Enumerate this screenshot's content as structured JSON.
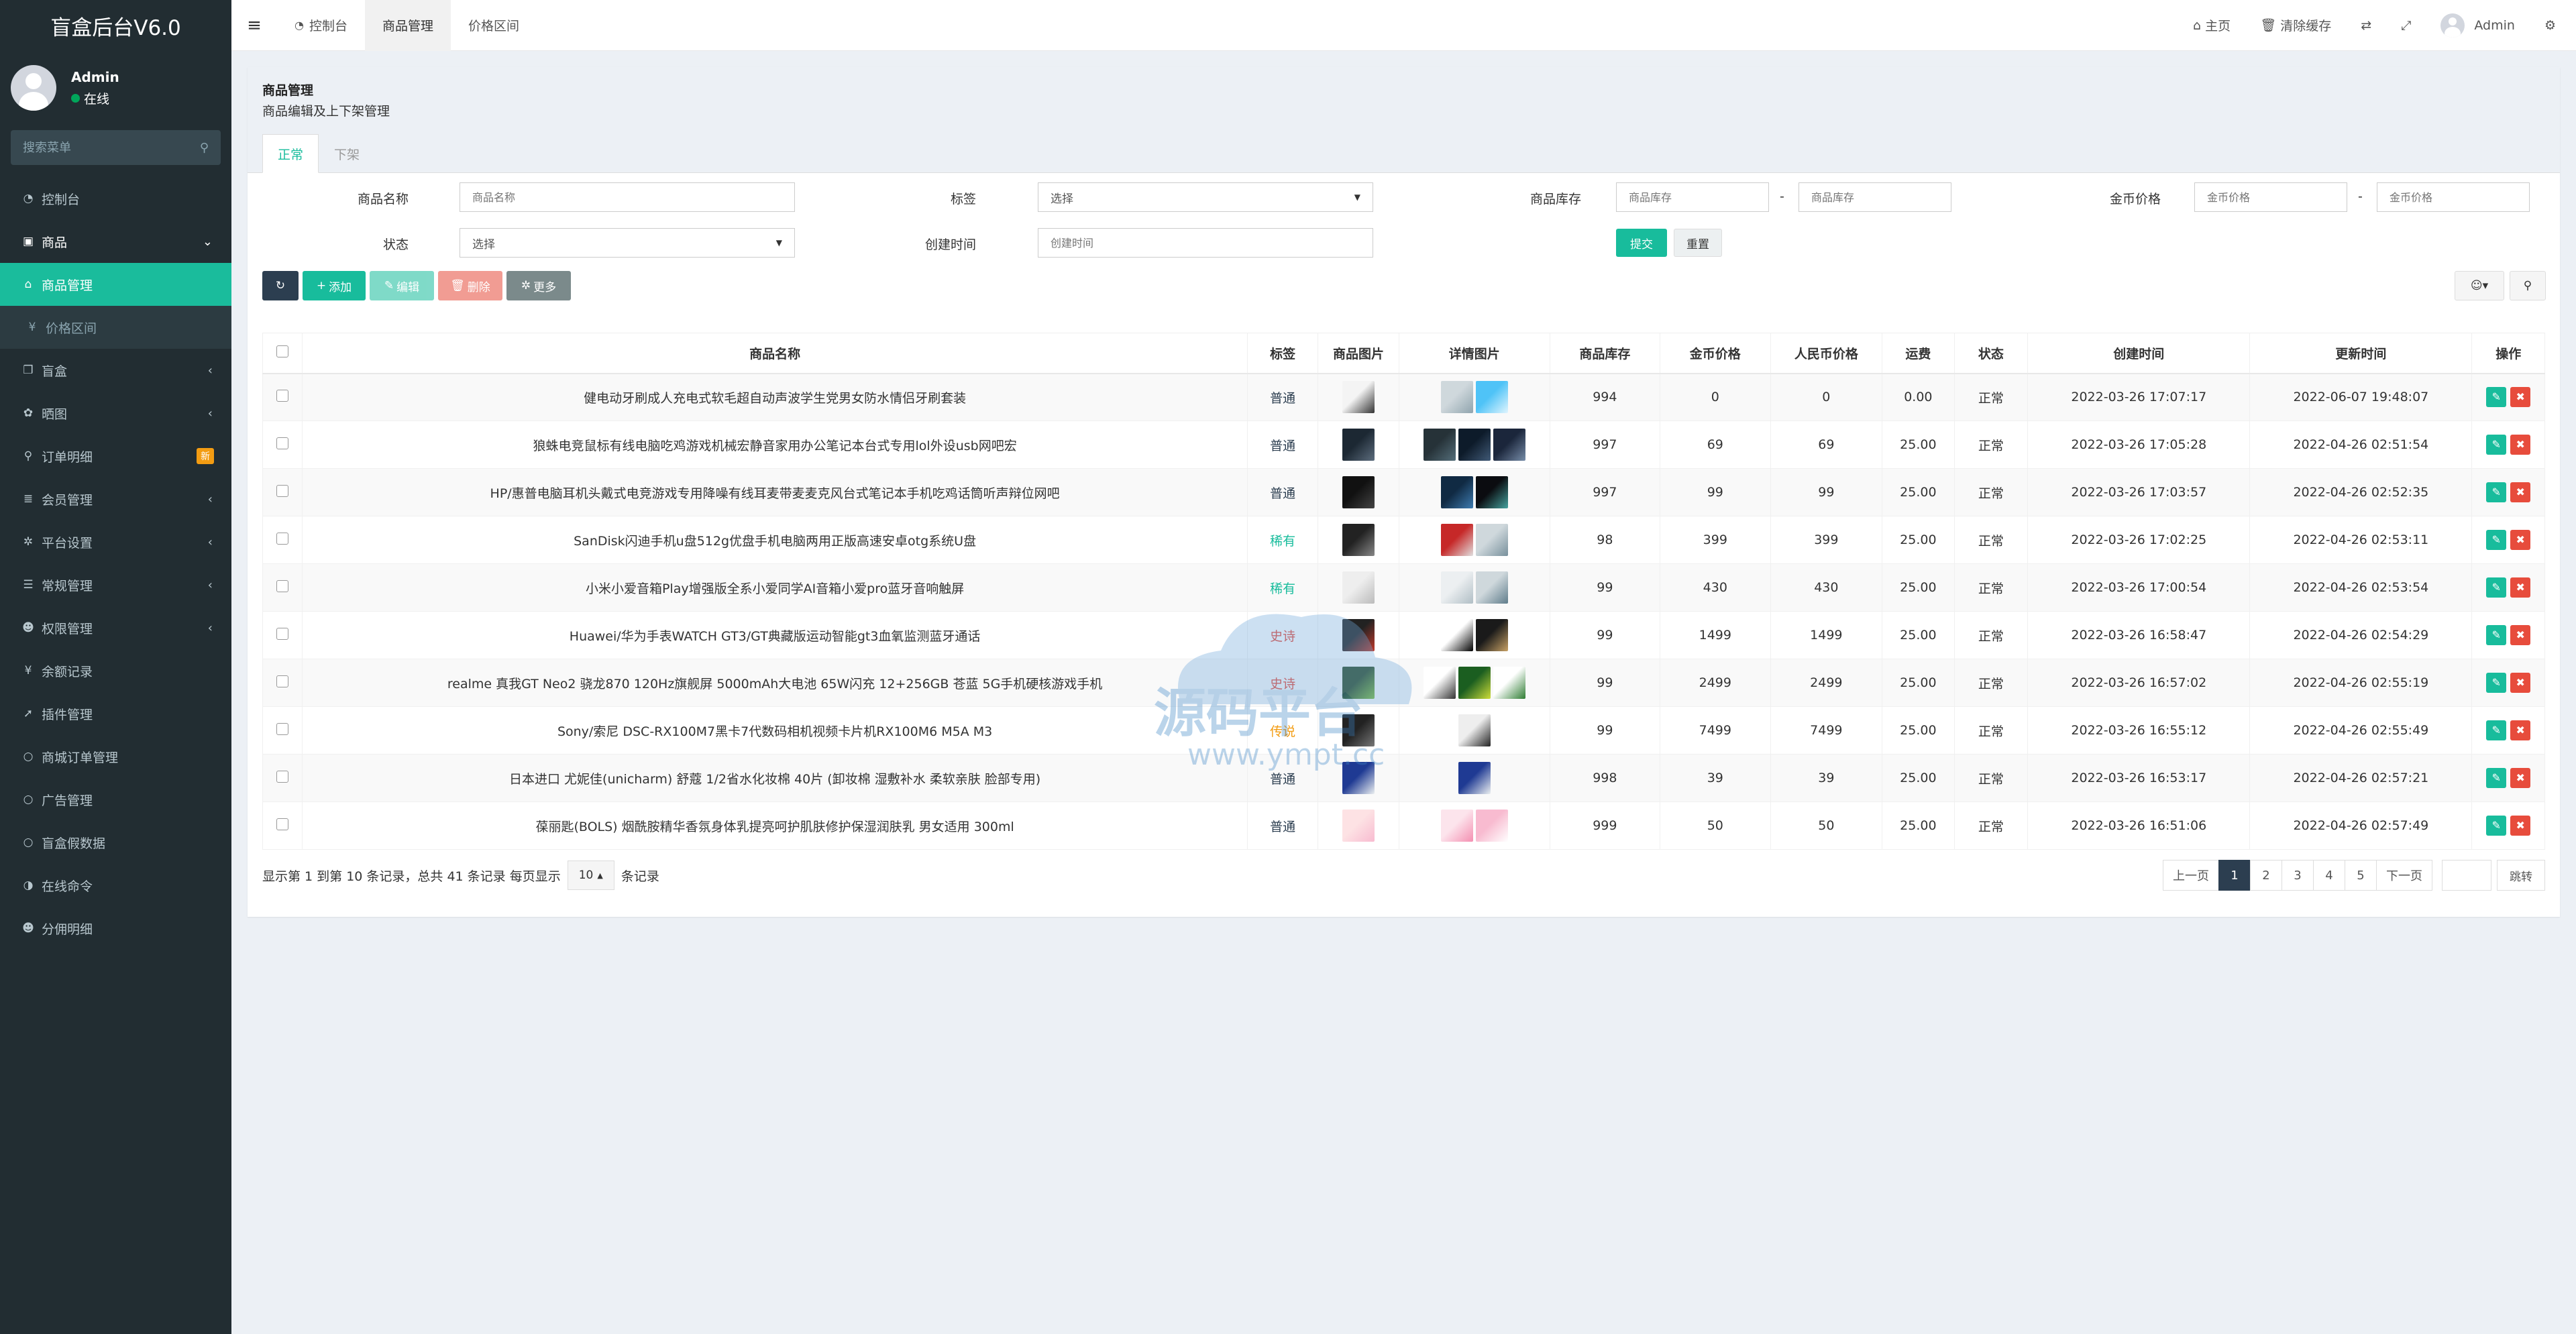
{
  "app": {
    "brand": "盲盒后台V6.0"
  },
  "user": {
    "name": "Admin",
    "status": "在线"
  },
  "sidebar": {
    "search_placeholder": "搜索菜单",
    "items": [
      {
        "icon": "dashboard-icon",
        "glyph": "◔",
        "label": "控制台"
      },
      {
        "icon": "shopping-bag-icon",
        "glyph": "▣",
        "label": "商品",
        "arrow": "⌄"
      },
      {
        "icon": "store-icon",
        "glyph": "⌂",
        "label": "商品管理"
      },
      {
        "icon": "yen-icon",
        "glyph": "¥",
        "label": "价格区间"
      },
      {
        "icon": "cube-icon",
        "glyph": "❒",
        "label": "盲盒",
        "arrow": "‹"
      },
      {
        "icon": "gift-icon",
        "glyph": "✿",
        "label": "晒图",
        "arrow": "‹"
      },
      {
        "icon": "cart-icon",
        "glyph": "⚲",
        "label": "订单明细",
        "badge": "新"
      },
      {
        "icon": "list-icon",
        "glyph": "≣",
        "label": "会员管理",
        "arrow": "‹"
      },
      {
        "icon": "cog-icon",
        "glyph": "✲",
        "label": "平台设置",
        "arrow": "‹"
      },
      {
        "icon": "list-alt-icon",
        "glyph": "☰",
        "label": "常规管理",
        "arrow": "‹"
      },
      {
        "icon": "users-icon",
        "glyph": "☻",
        "label": "权限管理",
        "arrow": "‹"
      },
      {
        "icon": "yen-icon",
        "glyph": "¥",
        "label": "余额记录"
      },
      {
        "icon": "rocket-icon",
        "glyph": "➚",
        "label": "插件管理"
      },
      {
        "icon": "circle-icon",
        "glyph": "○",
        "label": "商城订单管理"
      },
      {
        "icon": "circle-icon",
        "glyph": "○",
        "label": "广告管理"
      },
      {
        "icon": "circle-icon",
        "glyph": "○",
        "label": "盲盒假数据"
      },
      {
        "icon": "half-circle-icon",
        "glyph": "◑",
        "label": "在线命令"
      },
      {
        "icon": "users-icon",
        "glyph": "☻",
        "label": "分佣明细"
      }
    ]
  },
  "topnav": {
    "tabs": [
      {
        "icon": "dashboard-icon",
        "glyph": "◔",
        "label": "控制台"
      },
      {
        "label": "商品管理"
      },
      {
        "label": "价格区间"
      }
    ],
    "home": "主页",
    "clear_cache": "清除缓存",
    "username": "Admin"
  },
  "page": {
    "title": "商品管理",
    "subtitle": "商品编辑及上下架管理",
    "tabs": [
      "正常",
      "下架"
    ]
  },
  "filters": {
    "name_label": "商品名称",
    "name_placeholder": "商品名称",
    "tag_label": "标签",
    "tag_value": "选择",
    "stock_label": "商品库存",
    "stock_placeholder": "商品库存",
    "coin_label": "金币价格",
    "coin_placeholder": "金币价格",
    "status_label": "状态",
    "status_value": "选择",
    "created_label": "创建时间",
    "created_placeholder": "创建时间",
    "submit": "提交",
    "reset": "重置",
    "dash": "-"
  },
  "toolbar": {
    "add": "添加",
    "edit": "编辑",
    "delete": "删除",
    "more": "更多"
  },
  "table": {
    "headers": [
      "商品名称",
      "标签",
      "商品图片",
      "详情图片",
      "商品库存",
      "金币价格",
      "人民币价格",
      "运费",
      "状态",
      "创建时间",
      "更新时间",
      "操作"
    ],
    "rows": [
      {
        "name": "健电动牙刷成人充电式软毛超自动声波学生党男女防水情侣牙刷套装",
        "tag": "普通",
        "stock": "994",
        "coin": "0",
        "rmb": "0",
        "freight": "0.00",
        "status": "正常",
        "created": "2022-03-26 17:07:17",
        "updated": "2022-06-07 19:48:07"
      },
      {
        "name": "狼蛛电竞鼠标有线电脑吃鸡游戏机械宏静音家用办公笔记本台式专用lol外设usb网吧宏",
        "tag": "普通",
        "stock": "997",
        "coin": "69",
        "rmb": "69",
        "freight": "25.00",
        "status": "正常",
        "created": "2022-03-26 17:05:28",
        "updated": "2022-04-26 02:51:54"
      },
      {
        "name": "HP/惠普电脑耳机头戴式电竞游戏专用降噪有线耳麦带麦麦克风台式笔记本手机吃鸡话筒听声辩位网吧",
        "tag": "普通",
        "stock": "997",
        "coin": "99",
        "rmb": "99",
        "freight": "25.00",
        "status": "正常",
        "created": "2022-03-26 17:03:57",
        "updated": "2022-04-26 02:52:35"
      },
      {
        "name": "SanDisk闪迪手机u盘512g优盘手机电脑两用正版高速安卓otg系统U盘",
        "tag": "稀有",
        "stock": "98",
        "coin": "399",
        "rmb": "399",
        "freight": "25.00",
        "status": "正常",
        "created": "2022-03-26 17:02:25",
        "updated": "2022-04-26 02:53:11"
      },
      {
        "name": "小米小爱音箱Play增强版全系小爱同学AI音箱小爱pro蓝牙音响触屏",
        "tag": "稀有",
        "stock": "99",
        "coin": "430",
        "rmb": "430",
        "freight": "25.00",
        "status": "正常",
        "created": "2022-03-26 17:00:54",
        "updated": "2022-04-26 02:53:54"
      },
      {
        "name": "Huawei/华为手表WATCH GT3/GT典藏版运动智能gt3血氧监测蓝牙通话",
        "tag": "史诗",
        "stock": "99",
        "coin": "1499",
        "rmb": "1499",
        "freight": "25.00",
        "status": "正常",
        "created": "2022-03-26 16:58:47",
        "updated": "2022-04-26 02:54:29"
      },
      {
        "name": "realme 真我GT Neo2 骁龙870 120Hz旗舰屏 5000mAh大电池 65W闪充 12+256GB 苍蓝 5G手机硬核游戏手机",
        "tag": "史诗",
        "stock": "99",
        "coin": "2499",
        "rmb": "2499",
        "freight": "25.00",
        "status": "正常",
        "created": "2022-03-26 16:57:02",
        "updated": "2022-04-26 02:55:19"
      },
      {
        "name": "Sony/索尼 DSC-RX100M7黑卡7代数码相机视频卡片机RX100M6 M5A M3",
        "tag": "传说",
        "stock": "99",
        "coin": "7499",
        "rmb": "7499",
        "freight": "25.00",
        "status": "正常",
        "created": "2022-03-26 16:55:12",
        "updated": "2022-04-26 02:55:49"
      },
      {
        "name": "日本进口 尤妮佳(unicharm) 舒蔻 1/2省水化妆棉 40片 (卸妆棉 湿敷补水 柔软亲肤 脸部专用)",
        "tag": "普通",
        "stock": "998",
        "coin": "39",
        "rmb": "39",
        "freight": "25.00",
        "status": "正常",
        "created": "2022-03-26 16:53:17",
        "updated": "2022-04-26 02:57:21"
      },
      {
        "name": "葆丽匙(BOLS) 烟酰胺精华香氛身体乳提亮呵护肌肤修护保湿润肤乳 男女适用 300ml",
        "tag": "普通",
        "stock": "999",
        "coin": "50",
        "rmb": "50",
        "freight": "25.00",
        "status": "正常",
        "created": "2022-03-26 16:51:06",
        "updated": "2022-04-26 02:57:49"
      }
    ]
  },
  "tag_colors": {
    "普通": "#2c3e50",
    "稀有": "#18bc9c",
    "史诗": "#e74c3c",
    "传说": "#f39c12"
  },
  "pagination": {
    "info_prefix": "显示第 1 到第 10 条记录，总共 41 条记录 每页显示",
    "page_size": "10",
    "info_suffix": "条记录",
    "prev": "上一页",
    "pages": [
      "1",
      "2",
      "3",
      "4",
      "5"
    ],
    "next": "下一页",
    "jump": "跳转"
  },
  "colors": {
    "accent": "#18bc9c",
    "sidebar_bg": "#222d32",
    "danger": "#e74c3c",
    "dark": "#2c3e50"
  }
}
